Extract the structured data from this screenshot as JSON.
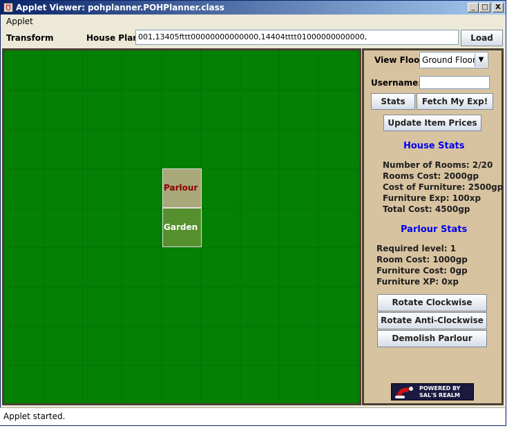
{
  "window": {
    "title": "Applet Viewer: pohplanner.POHPlanner.class",
    "minimize": "_",
    "maximize": "□",
    "close": "X"
  },
  "menubar": {
    "applet": "Applet"
  },
  "toolbar": {
    "transform_label": "Transform",
    "house_plan_label": "House Plan:",
    "house_plan_value": "001,13405fttt00000000000000,14404tttt01000000000000,",
    "load_label": "Load"
  },
  "grid": {
    "rooms": [
      {
        "label": "Parlour",
        "color": "#a8a878",
        "label_color": "#8b0000"
      },
      {
        "label": "Garden",
        "color": "#56902e",
        "label_color": "#ffffff"
      }
    ]
  },
  "side": {
    "view_floor_label": "View Floor:",
    "view_floor_value": "Ground Floor",
    "username_label": "Username:",
    "username_value": "",
    "stats_label": "Stats",
    "fetch_label": "Fetch My Exp!",
    "update_prices_label": "Update Item Prices",
    "house_stats_heading": "House Stats",
    "house_stats": [
      "Number of Rooms: 2/20",
      "Rooms Cost: 2000gp",
      "Cost of Furniture: 2500gp",
      "Furniture Exp: 100xp",
      "Total Cost: 4500gp"
    ],
    "room_stats_heading": "Parlour Stats",
    "room_stats": [
      "Required level: 1",
      "Room Cost: 1000gp",
      "Furniture Cost: 0gp",
      "Furniture XP: 0xp"
    ],
    "rotate_cw_label": "Rotate Clockwise",
    "rotate_acw_label": "Rotate Anti-Clockwise",
    "demolish_label": "Demolish Parlour",
    "logo_line1": "POWERED BY",
    "logo_line2": "SAL'S REALM"
  },
  "status": {
    "text": "Applet started."
  },
  "colors": {
    "grid_green": "#048004",
    "panel_tan": "#d8c3a0",
    "heading_blue": "#0000ee"
  }
}
